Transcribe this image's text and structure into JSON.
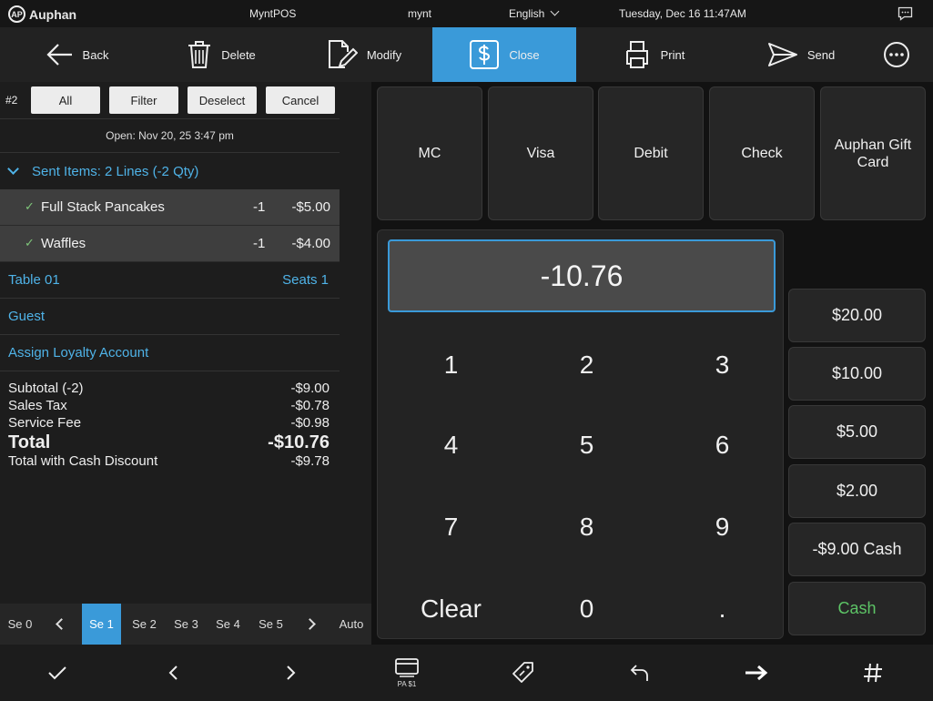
{
  "status": {
    "brand": "Auphan",
    "brand_mark": "AP",
    "app": "MyntPOS",
    "user": "mynt",
    "language": "English",
    "datetime": "Tuesday, Dec 16 11:47AM",
    "message_icon": "chat-icon"
  },
  "toolbar": {
    "back": "Back",
    "delete": "Delete",
    "modify": "Modify",
    "close": "Close",
    "print": "Print",
    "send": "Send"
  },
  "order": {
    "number": "#2",
    "chips": [
      "All",
      "Filter",
      "Deselect",
      "Cancel"
    ],
    "open_text": "Open: Nov 20, 25 3:47 pm",
    "sent_header": "Sent Items: 2 Lines (-2 Qty)",
    "items": [
      {
        "name": "Full Stack Pancakes",
        "qty": "-1",
        "price": "-$5.00"
      },
      {
        "name": "Waffles",
        "qty": "-1",
        "price": "-$4.00"
      }
    ],
    "table": "Table 01",
    "seats": "Seats 1",
    "guest": "Guest",
    "loyalty": "Assign Loyalty Account",
    "totals": {
      "subtotal_label": "Subtotal (-2)",
      "subtotal": "-$9.00",
      "tax_label": "Sales Tax",
      "tax": "-$0.78",
      "fee_label": "Service Fee",
      "fee": "-$0.98",
      "total_label": "Total",
      "total": "-$10.76",
      "cash_label": "Total with Cash Discount",
      "cash": "-$9.78"
    }
  },
  "seats_bar": {
    "items": [
      "Se 0",
      "Se 1",
      "Se 2",
      "Se 3",
      "Se 4",
      "Se 5"
    ],
    "active": "Se 1",
    "auto": "Auto"
  },
  "bottom": {
    "pa_label": "PA $1"
  },
  "tenders": [
    "MC",
    "Visa",
    "Debit",
    "Check",
    "Auphan Gift Card"
  ],
  "keypad": {
    "display": "-10.76",
    "keys": [
      "1",
      "2",
      "3",
      "4",
      "5",
      "6",
      "7",
      "8",
      "9",
      "Clear",
      "0",
      "."
    ]
  },
  "quick_cash": [
    "$20.00",
    "$10.00",
    "$5.00",
    "$2.00",
    "-$9.00 Cash",
    "Cash"
  ],
  "colors": {
    "accent": "#3a9ad9",
    "link": "#4fb3e8",
    "cash_green": "#5dc466",
    "selected_row": "#3e3e3e"
  }
}
